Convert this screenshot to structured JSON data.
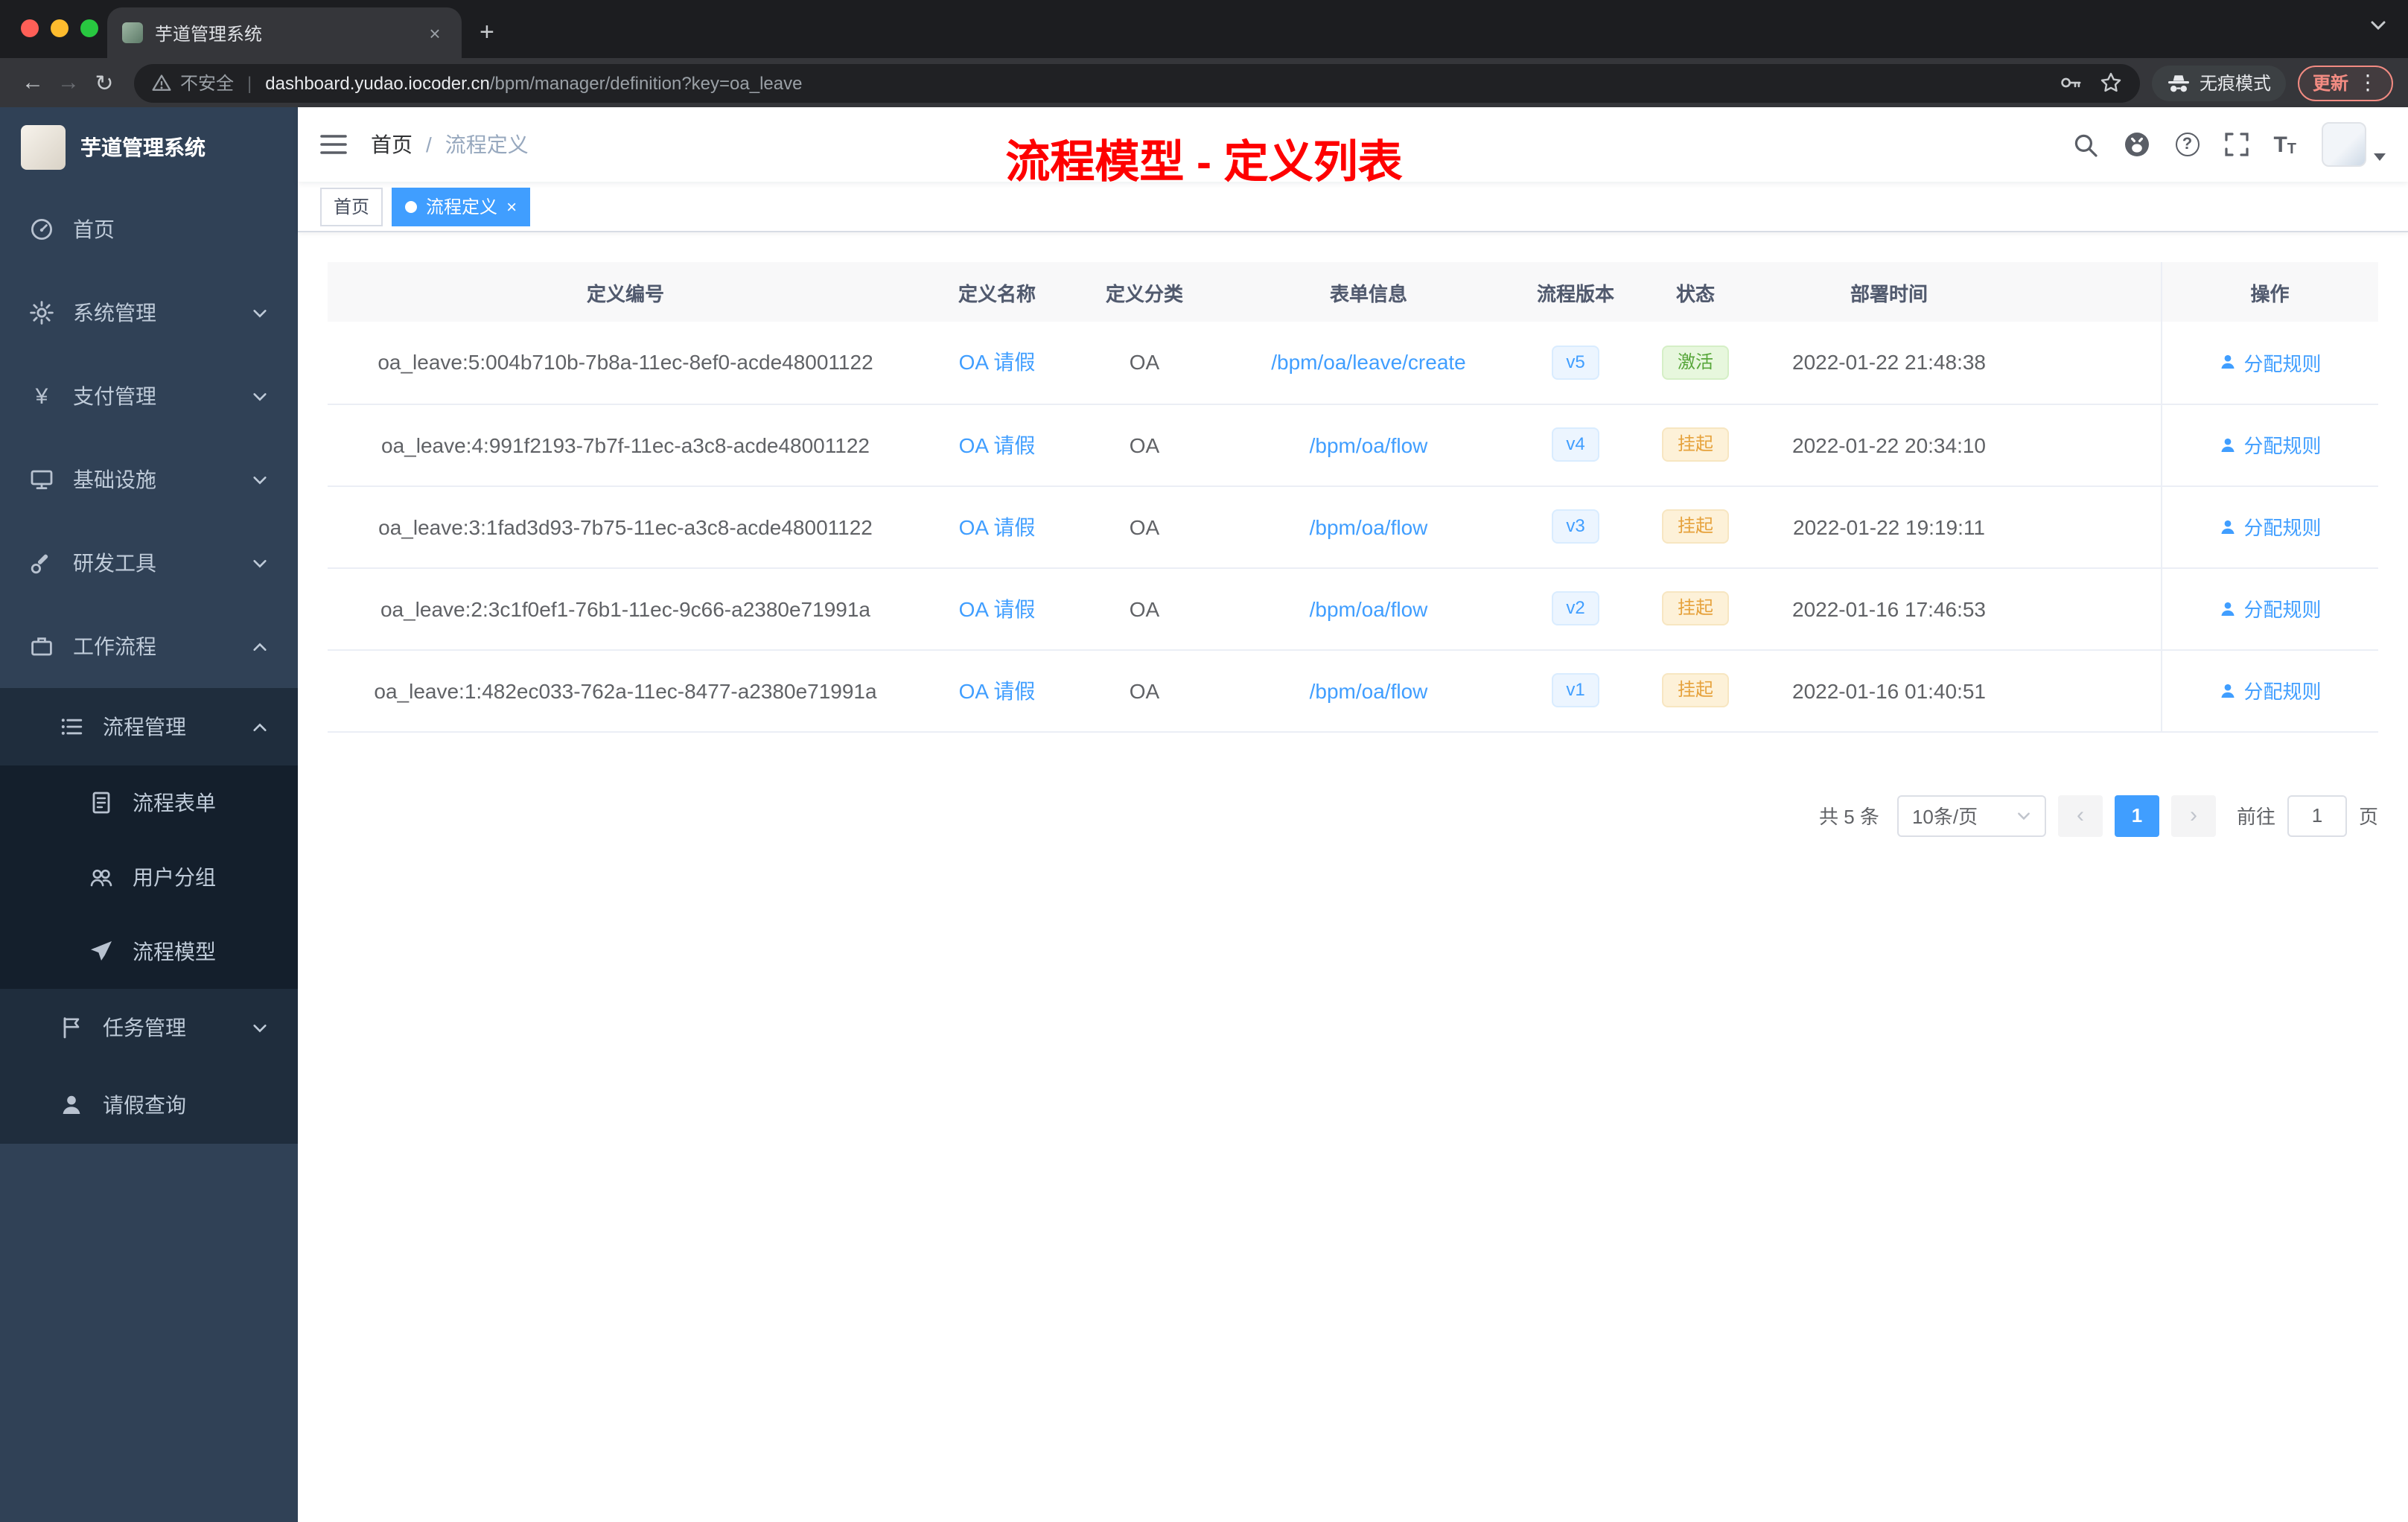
{
  "browser": {
    "tab_title": "芋道管理系统",
    "security_label": "不安全",
    "url_domain": "dashboard.yudao.iocoder.cn",
    "url_path": "/bpm/manager/definition?key=oa_leave",
    "incognito_label": "无痕模式",
    "update_label": "更新"
  },
  "glyphs": {
    "back": "←",
    "forward": "→",
    "reload": "↻",
    "new_tab": "+",
    "tab_close": "×",
    "kebab": "⋮",
    "yen": "¥",
    "help": "?",
    "font_large": "T",
    "font_small": "T",
    "prev": "‹",
    "next": "›",
    "tag_close": "×",
    "breadcrumb_sep": "/"
  },
  "sidebar": {
    "logo_title": "芋道管理系统",
    "menu": [
      {
        "label": "首页"
      },
      {
        "label": "系统管理"
      },
      {
        "label": "支付管理"
      },
      {
        "label": "基础设施"
      },
      {
        "label": "研发工具"
      },
      {
        "label": "工作流程"
      },
      {
        "label": "流程管理"
      },
      {
        "label": "流程表单"
      },
      {
        "label": "用户分组"
      },
      {
        "label": "流程模型"
      },
      {
        "label": "任务管理"
      },
      {
        "label": "请假查询"
      }
    ]
  },
  "header": {
    "breadcrumb": [
      "首页",
      "流程定义"
    ],
    "annotation": "流程模型 - 定义列表"
  },
  "tags": {
    "home": "首页",
    "active": "流程定义"
  },
  "table": {
    "columns": [
      "定义编号",
      "定义名称",
      "定义分类",
      "表单信息",
      "流程版本",
      "状态",
      "部署时间",
      "操作"
    ],
    "rows": [
      {
        "id": "oa_leave:5:004b710b-7b8a-11ec-8ef0-acde48001122",
        "name": "OA 请假",
        "category": "OA",
        "form": "/bpm/oa/leave/create",
        "version": "v5",
        "status": "激活",
        "status_type": "success",
        "deploy_time": "2022-01-22 21:48:38",
        "action": "分配规则"
      },
      {
        "id": "oa_leave:4:991f2193-7b7f-11ec-a3c8-acde48001122",
        "name": "OA 请假",
        "category": "OA",
        "form": "/bpm/oa/flow",
        "version": "v4",
        "status": "挂起",
        "status_type": "warning",
        "deploy_time": "2022-01-22 20:34:10",
        "action": "分配规则"
      },
      {
        "id": "oa_leave:3:1fad3d93-7b75-11ec-a3c8-acde48001122",
        "name": "OA 请假",
        "category": "OA",
        "form": "/bpm/oa/flow",
        "version": "v3",
        "status": "挂起",
        "status_type": "warning",
        "deploy_time": "2022-01-22 19:19:11",
        "action": "分配规则"
      },
      {
        "id": "oa_leave:2:3c1f0ef1-76b1-11ec-9c66-a2380e71991a",
        "name": "OA 请假",
        "category": "OA",
        "form": "/bpm/oa/flow",
        "version": "v2",
        "status": "挂起",
        "status_type": "warning",
        "deploy_time": "2022-01-16 17:46:53",
        "action": "分配规则"
      },
      {
        "id": "oa_leave:1:482ec033-762a-11ec-8477-a2380e71991a",
        "name": "OA 请假",
        "category": "OA",
        "form": "/bpm/oa/flow",
        "version": "v1",
        "status": "挂起",
        "status_type": "warning",
        "deploy_time": "2022-01-16 01:40:51",
        "action": "分配规则"
      }
    ]
  },
  "pagination": {
    "total": "共 5 条",
    "page_size": "10条/页",
    "current_page": "1",
    "goto_label": "前往",
    "goto_value": "1",
    "page_unit": "页"
  },
  "colors": {
    "accent": "#409eff",
    "success": "#67c23a",
    "warning": "#e6a23c",
    "annotation": "#fe0000",
    "sidebar_bg": "#304156"
  }
}
